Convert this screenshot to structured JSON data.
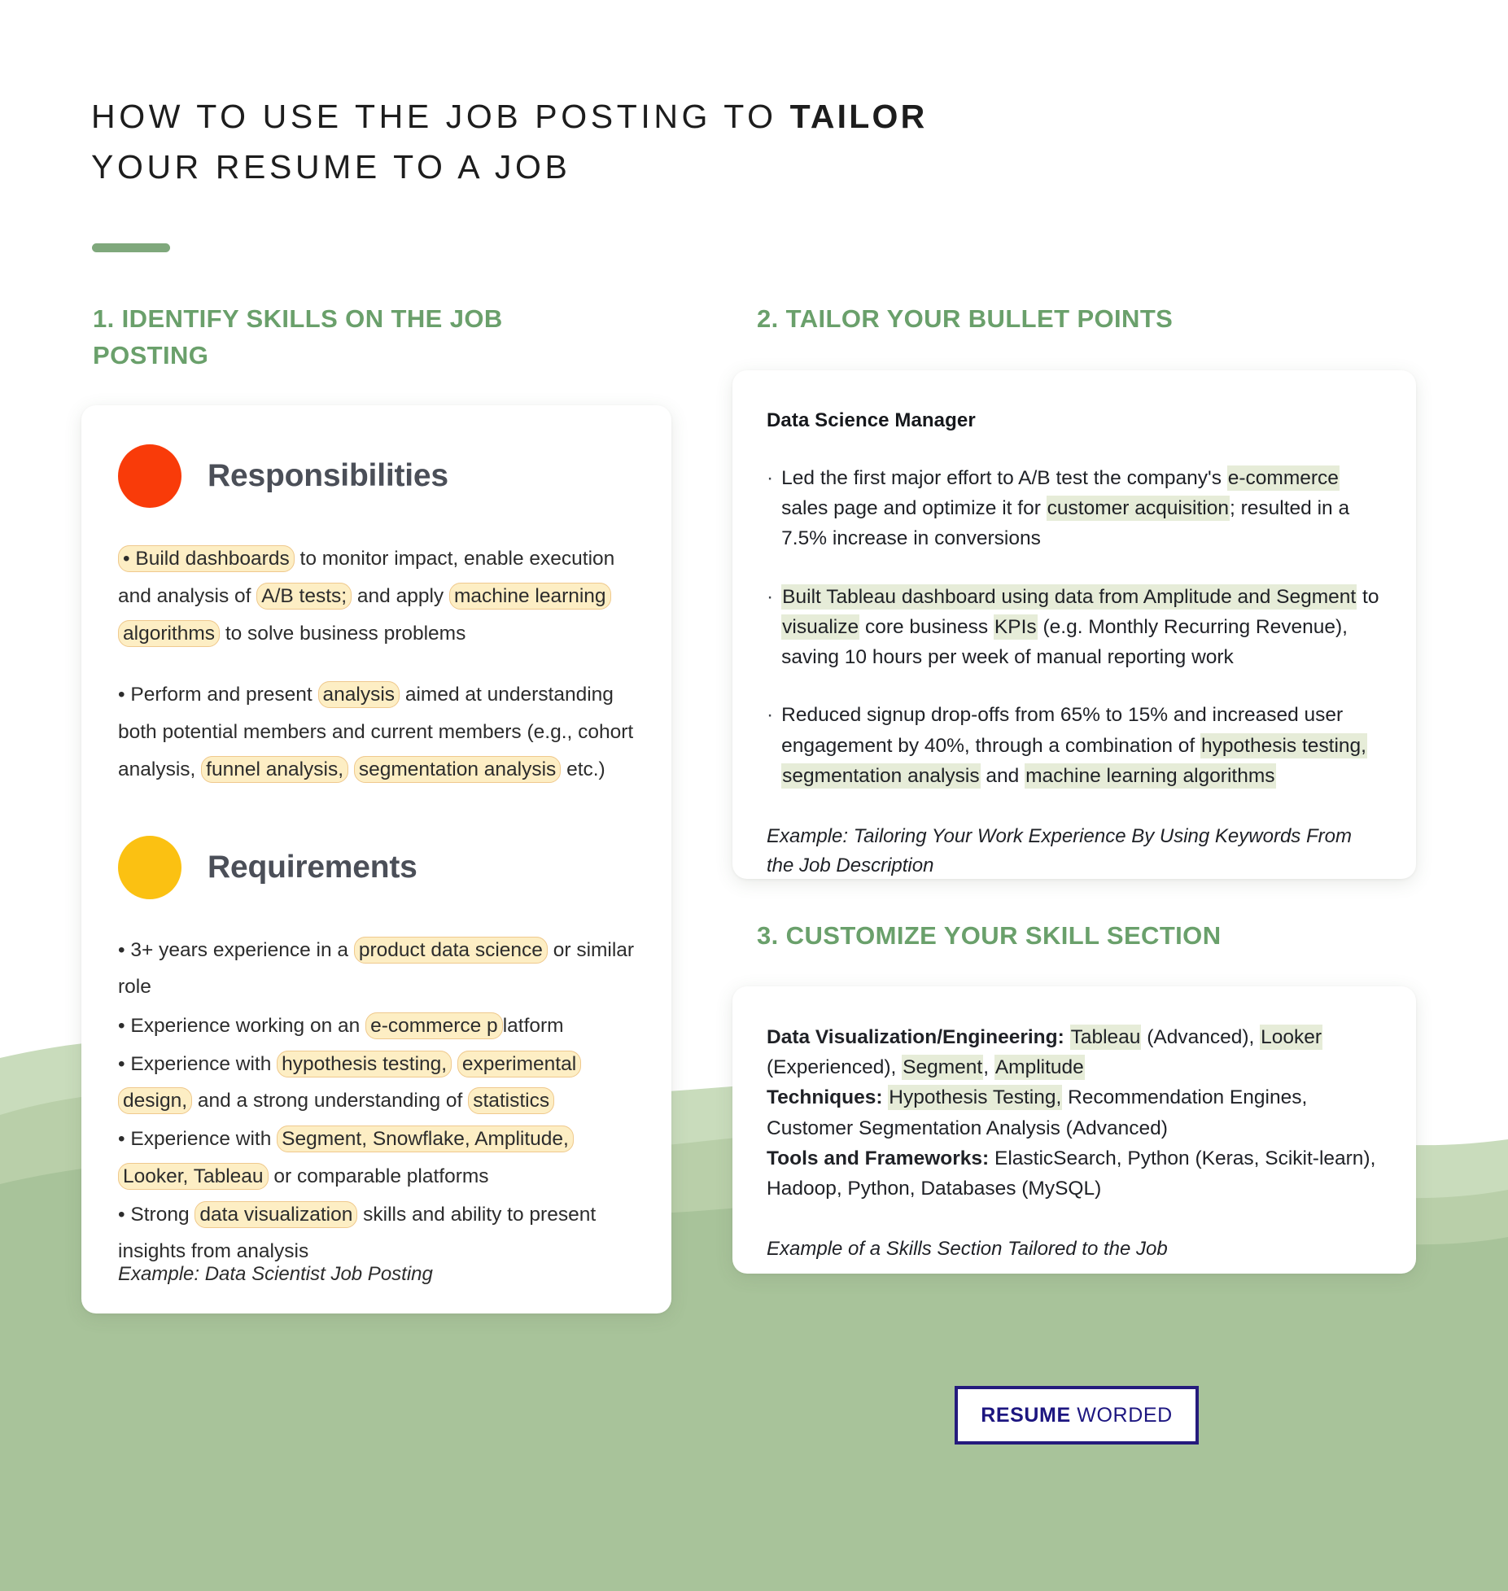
{
  "title": {
    "line1_pre": "HOW TO USE THE JOB POSTING TO ",
    "line1_bold": "TAILOR",
    "line2": "YOUR RESUME TO A JOB"
  },
  "colors": {
    "accent_green": "#7fa87c",
    "heading_green": "#6aa06b",
    "wave_green": "#a8c39a",
    "wave_green_light": "#c4d7b6",
    "dot_red": "#f93b09",
    "dot_yellow": "#fbc112",
    "highlight_yellow": "#fdeec4",
    "highlight_yellow_border": "#efc98e",
    "highlight_sage": "#e6ecd8",
    "logo_navy": "#251b7d"
  },
  "sections": {
    "one": {
      "heading": "1. IDENTIFY SKILLS ON THE JOB POSTING"
    },
    "two": {
      "heading": "2. TAILOR YOUR BULLET POINTS"
    },
    "three": {
      "heading": "3. CUSTOMIZE YOUR SKILL SECTION"
    }
  },
  "job_posting_card": {
    "responsibilities": {
      "label": "Responsibilities",
      "dot_color": "#f93b09",
      "bullets": [
        {
          "segments": [
            {
              "text": "• Build dashboards",
              "highlight": true
            },
            {
              "text": " to monitor impact, enable execution and analysis of ",
              "highlight": false
            },
            {
              "text": "A/B tests;",
              "highlight": true
            },
            {
              "text": " and apply ",
              "highlight": false
            },
            {
              "text": "machine learning algorithms",
              "highlight": true
            },
            {
              "text": " to solve business problems",
              "highlight": false
            }
          ]
        },
        {
          "segments": [
            {
              "text": "• Perform and present ",
              "highlight": false
            },
            {
              "text": "analysis",
              "highlight": true
            },
            {
              "text": " aimed at understanding both potential members and current members (e.g., cohort analysis, ",
              "highlight": false
            },
            {
              "text": "funnel analysis,",
              "highlight": true
            },
            {
              "text": " ",
              "highlight": false
            },
            {
              "text": "segmentation analysis",
              "highlight": true
            },
            {
              "text": " etc.)",
              "highlight": false
            }
          ]
        }
      ]
    },
    "requirements": {
      "label": "Requirements",
      "dot_color": "#fbc112",
      "bullets": [
        {
          "segments": [
            {
              "text": "• 3+ years experience in a ",
              "highlight": false
            },
            {
              "text": "product data science",
              "highlight": true
            },
            {
              "text": " or similar role",
              "highlight": false
            }
          ]
        },
        {
          "segments": [
            {
              "text": "• Experience working on an ",
              "highlight": false
            },
            {
              "text": "e-commerce p",
              "highlight": true
            },
            {
              "text": "latform",
              "highlight": false
            }
          ]
        },
        {
          "segments": [
            {
              "text": "• Experience with ",
              "highlight": false
            },
            {
              "text": "hypothesis testing,",
              "highlight": true
            },
            {
              "text": " ",
              "highlight": false
            },
            {
              "text": "experimental design,",
              "highlight": true
            },
            {
              "text": " and a strong understanding of ",
              "highlight": false
            },
            {
              "text": "statistics",
              "highlight": true
            }
          ]
        },
        {
          "segments": [
            {
              "text": "• Experience with ",
              "highlight": false
            },
            {
              "text": "Segment, Snowflake, Amplitude, Looker, Tableau",
              "highlight": true
            },
            {
              "text": " or comparable platforms",
              "highlight": false
            }
          ]
        },
        {
          "segments": [
            {
              "text": "• Strong ",
              "highlight": false
            },
            {
              "text": "data visualization",
              "highlight": true
            },
            {
              "text": " skills and ability to present insights from analysis",
              "highlight": false
            }
          ]
        }
      ]
    },
    "example_note": "Example: Data Scientist Job Posting"
  },
  "bullets_card": {
    "job_title": "Data Science Manager",
    "bullet_marker": "·",
    "bullets": [
      {
        "segments": [
          {
            "text": "Led the first major effort to A/B test the company's ",
            "highlight": false
          },
          {
            "text": "e-commerce",
            "highlight": true
          },
          {
            "text": " sales page and optimize it for ",
            "highlight": false
          },
          {
            "text": "customer acquisition",
            "highlight": true
          },
          {
            "text": "; resulted in a 7.5% increase in conversions",
            "highlight": false
          }
        ]
      },
      {
        "segments": [
          {
            "text": "Built Tableau dashboard using data from Amplitude and Segment",
            "highlight": true
          },
          {
            "text": " to ",
            "highlight": false
          },
          {
            "text": "visualize",
            "highlight": true
          },
          {
            "text": " core business ",
            "highlight": false
          },
          {
            "text": "KPIs",
            "highlight": true
          },
          {
            "text": " (e.g. Monthly Recurring Revenue), saving 10 hours per week of manual reporting work",
            "highlight": false
          }
        ]
      },
      {
        "segments": [
          {
            "text": "Reduced signup drop-offs from 65% to 15% and increased user engagement by 40%, through a combination of ",
            "highlight": false
          },
          {
            "text": "hypothesis testing,",
            "highlight": true
          },
          {
            "text": " ",
            "highlight": false
          },
          {
            "text": "segmentation analysis",
            "highlight": true
          },
          {
            "text": " and ",
            "highlight": false
          },
          {
            "text": "machine learning algorithms",
            "highlight": true
          }
        ]
      }
    ],
    "example_note": "Example: Tailoring Your Work Experience By Using Keywords From the Job Description"
  },
  "skills_card": {
    "lines": [
      {
        "segments": [
          {
            "text": "Data Visualization/Engineering:",
            "bold": true,
            "highlight": false
          },
          {
            "text": " ",
            "bold": false,
            "highlight": false
          },
          {
            "text": "Tableau",
            "bold": false,
            "highlight": true
          },
          {
            "text": " (Advanced), ",
            "bold": false,
            "highlight": false
          },
          {
            "text": "Looker",
            "bold": false,
            "highlight": true
          },
          {
            "text": " (Experienced), ",
            "bold": false,
            "highlight": false
          },
          {
            "text": "Segment",
            "bold": false,
            "highlight": true
          },
          {
            "text": ", ",
            "bold": false,
            "highlight": false
          },
          {
            "text": "Amplitude",
            "bold": false,
            "highlight": true
          }
        ]
      },
      {
        "segments": [
          {
            "text": "Techniques:",
            "bold": true,
            "highlight": false
          },
          {
            "text": " ",
            "bold": false,
            "highlight": false
          },
          {
            "text": "Hypothesis Testing,",
            "bold": false,
            "highlight": true
          },
          {
            "text": " Recommendation Engines, Customer Segmentation Analysis (Advanced)",
            "bold": false,
            "highlight": false
          }
        ]
      },
      {
        "segments": [
          {
            "text": "Tools and Frameworks:",
            "bold": true,
            "highlight": false
          },
          {
            "text": " ElasticSearch, Python (Keras, Scikit-learn), Hadoop, Python, Databases (MySQL)",
            "bold": false,
            "highlight": false
          }
        ]
      }
    ],
    "example_note": "Example of a Skills Section Tailored to the Job"
  },
  "logo": {
    "bold_word": "RESUME",
    "light_word": " WORDED"
  }
}
